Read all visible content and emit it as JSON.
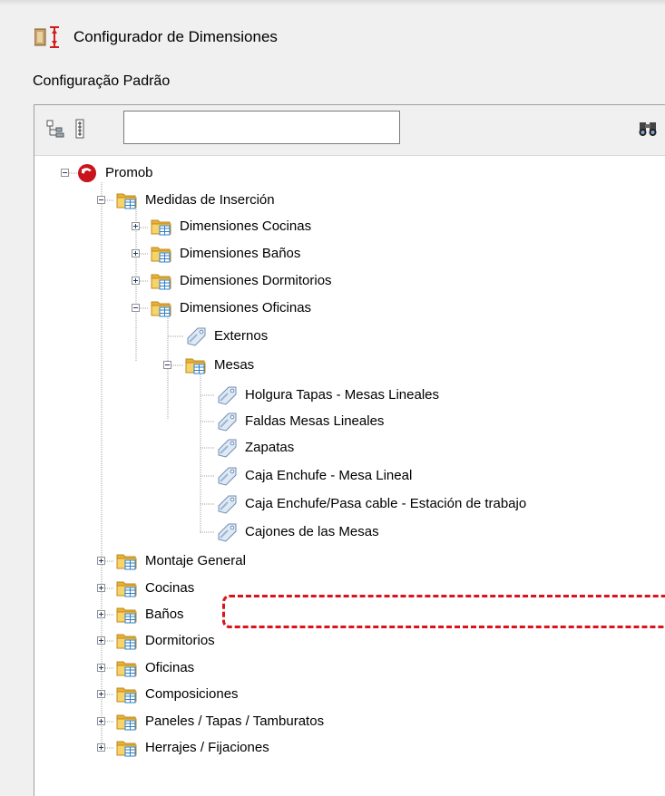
{
  "window": {
    "title": "Configurador de Dimensiones",
    "icon": "ruler-dimension-icon"
  },
  "config_label": "Configuração Padrão",
  "toolbar": {
    "expand_all_icon": "expand-all-icon",
    "collapse_all_icon": "collapse-all-icon",
    "search_value": "",
    "find_icon": "binoculars-icon"
  },
  "tree": {
    "root": "Promob",
    "medidas": "Medidas de Inserción",
    "dim_cocinas": "Dimensiones Cocinas",
    "dim_banos": "Dimensiones Baños",
    "dim_dormitorios": "Dimensiones Dormitorios",
    "dim_oficinas": "Dimensiones Oficinas",
    "externos": "Externos",
    "mesas": "Mesas",
    "holgura": "Holgura Tapas - Mesas Lineales",
    "faldas": "Faldas Mesas Lineales",
    "zapatas": "Zapatas",
    "caja_lineal": "Caja Enchufe - Mesa Lineal",
    "caja_estacion": "Caja Enchufe/Pasa cable - Estación de trabajo",
    "cajones": "Cajones de las Mesas",
    "montaje": "Montaje General",
    "cocinas": "Cocinas",
    "banos": "Baños",
    "dormitorios": "Dormitorios",
    "oficinas": "Oficinas",
    "composiciones": "Composiciones",
    "paneles": "Paneles / Tapas / Tamburatos",
    "herrajes": "Herrajes / Fijaciones"
  },
  "colors": {
    "highlight_border": "#d9131b",
    "folder": "#f2c64e",
    "table_icon": "#2f7fc8",
    "promob_red": "#c8141c"
  }
}
